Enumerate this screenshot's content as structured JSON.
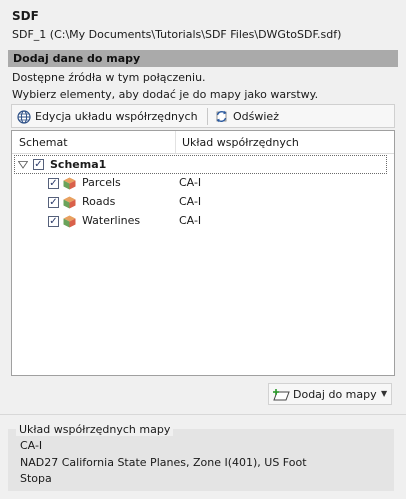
{
  "title": "SDF",
  "connection": "SDF_1 (C:\\My Documents\\Tutorials\\SDF Files\\DWGtoSDF.sdf)",
  "section_title": "Dodaj dane do mapy",
  "desc": [
    "Dostępne źródła w tym połączeniu.",
    "Wybierz elementy, aby dodać je do mapy jako warstwy."
  ],
  "toolbar": {
    "edit_cs_label": "Edycja układu współrzędnych",
    "refresh_label": "Odśwież"
  },
  "grid": {
    "columns": [
      "Schemat",
      "Układ współrzędnych"
    ],
    "schema": {
      "name": "Schema1",
      "checked": true,
      "expanded": true
    },
    "rows": [
      {
        "name": "Parcels",
        "cs": "CA-I",
        "checked": true
      },
      {
        "name": "Roads",
        "cs": "CA-I",
        "checked": true
      },
      {
        "name": "Waterlines",
        "cs": "CA-I",
        "checked": true
      }
    ]
  },
  "add_button_label": "Dodaj do mapy",
  "map_cs": {
    "title": "Układ współrzędnych mapy",
    "code": "CA-I",
    "description": "NAD27 California State Planes, Zone I(401), US Foot",
    "unit": "Stopa"
  }
}
